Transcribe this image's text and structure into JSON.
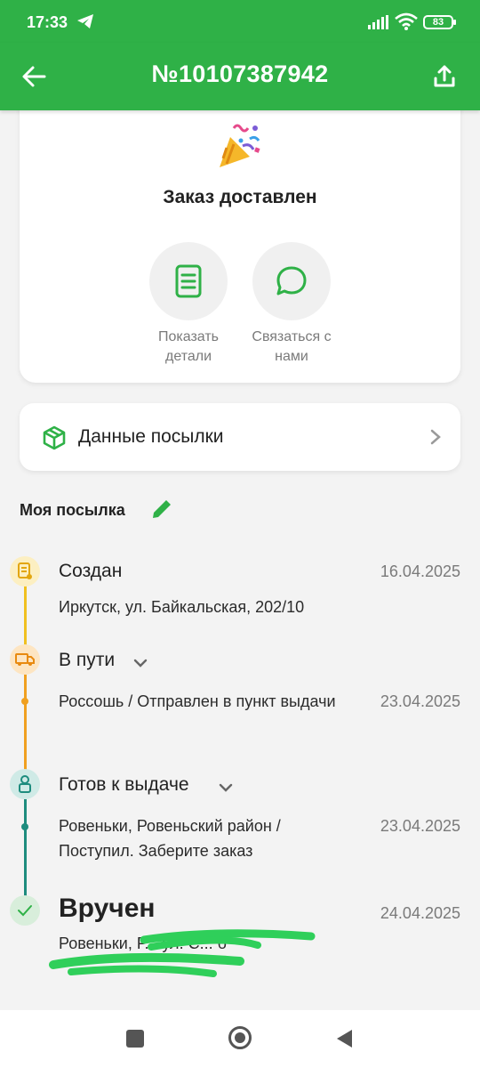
{
  "status_bar": {
    "time": "17:33",
    "battery": "83"
  },
  "header": {
    "title": "№10107387942"
  },
  "status_card": {
    "title": "Заказ доставлен",
    "actions": [
      {
        "label": "Показать детали"
      },
      {
        "label": "Связаться с нами"
      }
    ]
  },
  "parcel_card": {
    "label": "Данные посылки"
  },
  "my_parcel": {
    "title": "Моя посылка"
  },
  "timeline": [
    {
      "title": "Создан",
      "date": "16.04.2025",
      "desc": "Иркутск, ул. Байкальская, 202/10",
      "color": "#f0c020"
    },
    {
      "title": "В пути",
      "date": "23.04.2025",
      "desc": "Россошь / Отправлен в пункт выдачи",
      "color": "#f0a020"
    },
    {
      "title": "Готов к выдаче",
      "date": "23.04.2025",
      "desc": "Ровеньки, Ровеньский район / Поступил. Заберите заказ",
      "color": "#1e8c7e"
    },
    {
      "title": "Вручен",
      "date": "24.04.2025",
      "desc": "Ровеньки, Р... ул. С... б",
      "color": "#2fb147"
    }
  ],
  "colors": {
    "accent": "#2fb147",
    "background": "#f3f3f3"
  }
}
